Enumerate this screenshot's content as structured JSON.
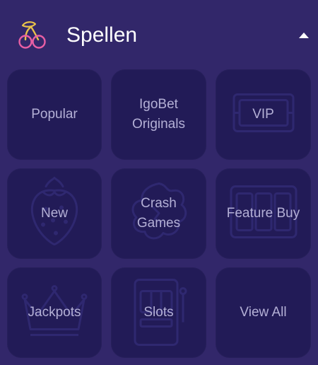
{
  "header": {
    "icon": "cherries-icon",
    "title": "Spellen",
    "toggle_icon": "caret-up-icon"
  },
  "colors": {
    "background": "#32276a",
    "tile": "#221b57",
    "tile_text": "#b4b0d6",
    "title_text": "#ffffff",
    "cherry_stem": "#e8c24a",
    "cherry_fruit": "#e85fa4"
  },
  "tiles": [
    {
      "label": "Popular",
      "icon": "none"
    },
    {
      "label": "IgoBet\nOriginals",
      "icon": "none"
    },
    {
      "label": "VIP",
      "icon": "vip-frame-icon"
    },
    {
      "label": "New",
      "icon": "strawberry-icon"
    },
    {
      "label": "Crash\nGames",
      "icon": "explosion-icon"
    },
    {
      "label": "Feature Buy",
      "icon": "slot-reels-icon"
    },
    {
      "label": "Jackpots",
      "icon": "crown-icon"
    },
    {
      "label": "Slots",
      "icon": "slot-machine-icon"
    },
    {
      "label": "View All",
      "icon": "none"
    }
  ]
}
